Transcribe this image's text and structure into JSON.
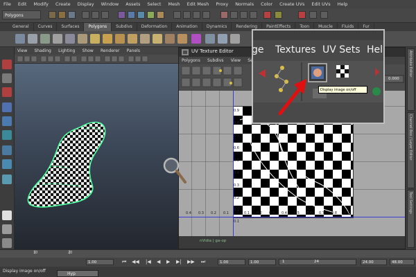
{
  "menubar": [
    "File",
    "Edit",
    "Modify",
    "Create",
    "Display",
    "Window",
    "Assets",
    "Select",
    "Mesh",
    "Edit Mesh",
    "Proxy",
    "Normals",
    "Color",
    "Create UVs",
    "Edit UVs",
    "Help"
  ],
  "statusline": {
    "mode": "Polygons"
  },
  "shelf": {
    "tabs": [
      "General",
      "Curves",
      "Surfaces",
      "Polygons",
      "Subdivs",
      "Deformation",
      "Animation",
      "Dynamics",
      "Rendering",
      "PaintEffects",
      "Toon",
      "Muscle",
      "Fluids",
      "Fur"
    ],
    "active": "Polygons"
  },
  "viewport": {
    "menu": [
      "View",
      "Shading",
      "Lighting",
      "Show",
      "Renderer",
      "Panels"
    ]
  },
  "uv_editor": {
    "title": "UV Texture Editor",
    "menu": [
      "Polygons",
      "Subdivs",
      "View",
      "Select"
    ],
    "status": "nVidia | ga-op"
  },
  "uv_axis": {
    "v_labels": [
      "0.9",
      "0.8",
      "0.7",
      "0.6",
      "0.5",
      "0.4",
      "0.3",
      "0.2",
      "0.1"
    ],
    "u_labels": [
      "0.4",
      "0.3",
      "0.2",
      "0.1",
      "0.1",
      "0.2",
      "0.3",
      "0.4",
      "0.5",
      "0.6",
      "0.7",
      "0.8",
      "0.9"
    ],
    "below_label": "0.1"
  },
  "zoom_popup": {
    "menu": [
      "ge",
      "Textures",
      "UV Sets",
      "Help"
    ],
    "tooltip": "Display image on/off"
  },
  "uv_field_value": "0.000",
  "right_tabs": [
    "Attribute Editor",
    "Channel Box / Layer Editor",
    "Tool Settings"
  ],
  "timeline": {
    "ticks": [
      "10",
      "20"
    ]
  },
  "range": {
    "start": "1.00",
    "current_a": "1.00",
    "frame_a": "1",
    "frame_b": "24",
    "end_a": "24.00",
    "end_b": "48.00",
    "mid": "1.00"
  },
  "helpline": "Display image on/off",
  "taskbar_label": "Hyp",
  "colors": {
    "arrow": "#e01010",
    "uv_mesh": "#4dff9f",
    "accent": "#5c5c5c"
  }
}
